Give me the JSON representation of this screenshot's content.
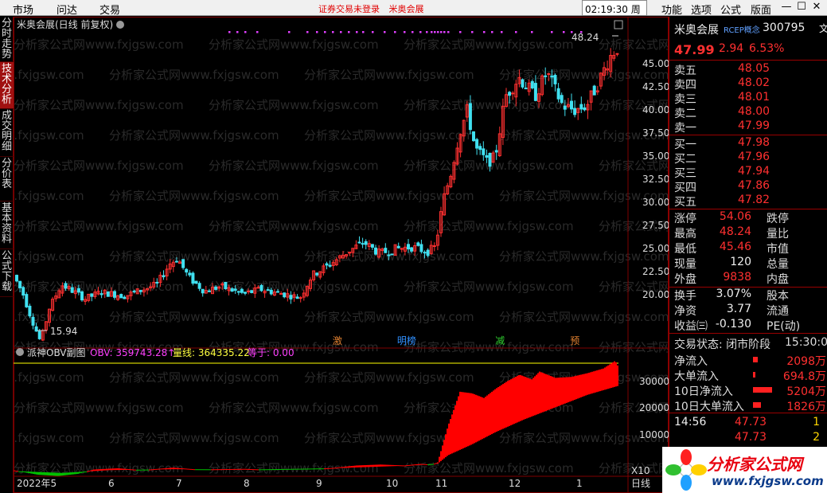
{
  "menu": {
    "items": [
      "市场",
      "问达",
      "交易"
    ],
    "notices": [
      "证券交易未登录",
      "米奥会展"
    ],
    "clock": "02:19:30 周三",
    "right_items": [
      "功能",
      "选项",
      "公式",
      "版面"
    ],
    "win_buttons": [
      "—",
      "☐",
      "✕"
    ]
  },
  "left_tabs": [
    "分时走势",
    "技术分析",
    "成交明细",
    "分价表",
    "基本资料",
    "公式下载"
  ],
  "chart": {
    "title": "米奥会展(日线 前复权)",
    "high_label": "48.24",
    "low_label": "15.94",
    "price_ticks": [
      "45.00",
      "42.50",
      "40.00",
      "37.50",
      "35.00",
      "32.50",
      "30.00",
      "27.50",
      "25.00",
      "22.50",
      "20.00"
    ],
    "markers": [
      {
        "text": "激",
        "color": "#e08030",
        "x_frac": 0.52
      },
      {
        "text": "明榜",
        "color": "#3090ff",
        "x_frac": 0.625
      },
      {
        "text": "减",
        "color": "#30d030",
        "x_frac": 0.785
      },
      {
        "text": "预",
        "color": "#e08030",
        "x_frac": 0.907
      }
    ],
    "sub_title": "派神OBV副图",
    "sub_obv": "OBV: 359743.28↑",
    "sub_ma": "量线: 364335.22",
    "sub_eq": "等于: 0.00",
    "sub_ticks": [
      "30000",
      "20000",
      "10000"
    ],
    "x_labels": [
      "2022年5",
      "6",
      "7",
      "8",
      "9",
      "10",
      "11",
      "12",
      "1"
    ],
    "x10": "X10",
    "period": "日线"
  },
  "chart_data": {
    "type": "candlestick",
    "price_range": [
      15.94,
      48.24
    ],
    "sub_range": [
      0,
      36000
    ]
  },
  "panel": {
    "name": "米奥会展",
    "tag": "RCEP概念",
    "code": "300795",
    "side": "文",
    "price": "47.99",
    "change": "2.94",
    "pct": "6.53%",
    "asks": [
      {
        "label": "卖五",
        "price": "48.05",
        "vol": ""
      },
      {
        "label": "卖四",
        "price": "48.02",
        "vol": ""
      },
      {
        "label": "卖三",
        "price": "48.01",
        "vol": ""
      },
      {
        "label": "卖二",
        "price": "48.00",
        "vol": ""
      },
      {
        "label": "卖一",
        "price": "47.99",
        "vol": ""
      }
    ],
    "bids": [
      {
        "label": "买一",
        "price": "47.98",
        "vol": ""
      },
      {
        "label": "买二",
        "price": "47.96",
        "vol": ""
      },
      {
        "label": "买三",
        "price": "47.94",
        "vol": ""
      },
      {
        "label": "买四",
        "price": "47.86",
        "vol": ""
      },
      {
        "label": "买五",
        "price": "47.82",
        "vol": ""
      }
    ],
    "stats": [
      {
        "l1": "涨停",
        "v1": "54.06",
        "c1": "red",
        "l2": "跌停"
      },
      {
        "l1": "最高",
        "v1": "48.24",
        "c1": "red",
        "l2": "量比"
      },
      {
        "l1": "最低",
        "v1": "45.46",
        "c1": "red",
        "l2": "市值"
      },
      {
        "l1": "现量",
        "v1": "120",
        "c1": "wht",
        "l2": "总量"
      },
      {
        "l1": "外盘",
        "v1": "9838",
        "c1": "red",
        "l2": "内盘"
      }
    ],
    "stats2": [
      {
        "l1": "换手",
        "v1": "3.07%",
        "l2": "股本"
      },
      {
        "l1": "净资",
        "v1": "3.77",
        "l2": "流通"
      },
      {
        "l1": "收益㈢",
        "v1": "-0.130",
        "l2": "PE(动)"
      }
    ],
    "status_label": "交易状态: 闭市阶段",
    "status_time": "15:30:0",
    "flows": [
      {
        "label": "净流入",
        "value": "2098万",
        "bar": 0.08
      },
      {
        "label": "大单流入",
        "value": "694.8万",
        "bar": 0.03
      },
      {
        "label": "10日净流入",
        "value": "5204万",
        "bar": 0.3
      },
      {
        "label": "10日大单流入",
        "value": "1826万",
        "bar": 0.12
      }
    ],
    "ticks": [
      {
        "time": "14:56",
        "price": "47.73",
        "vol": "1"
      },
      {
        "time": "",
        "price": "47.73",
        "vol": "2"
      }
    ]
  },
  "watermark": "分析家公式网www.fxjgsw.com",
  "logo": {
    "name": "分析家公式网",
    "url": "www.fxjgsw.com"
  },
  "colors": {
    "up": "#ff3030",
    "down": "#40e0f0",
    "bg": "#000000",
    "grid": "#800000",
    "obv_up": "#ff0000",
    "obv_down": "#00c000",
    "ma_line": "#ffff00"
  }
}
